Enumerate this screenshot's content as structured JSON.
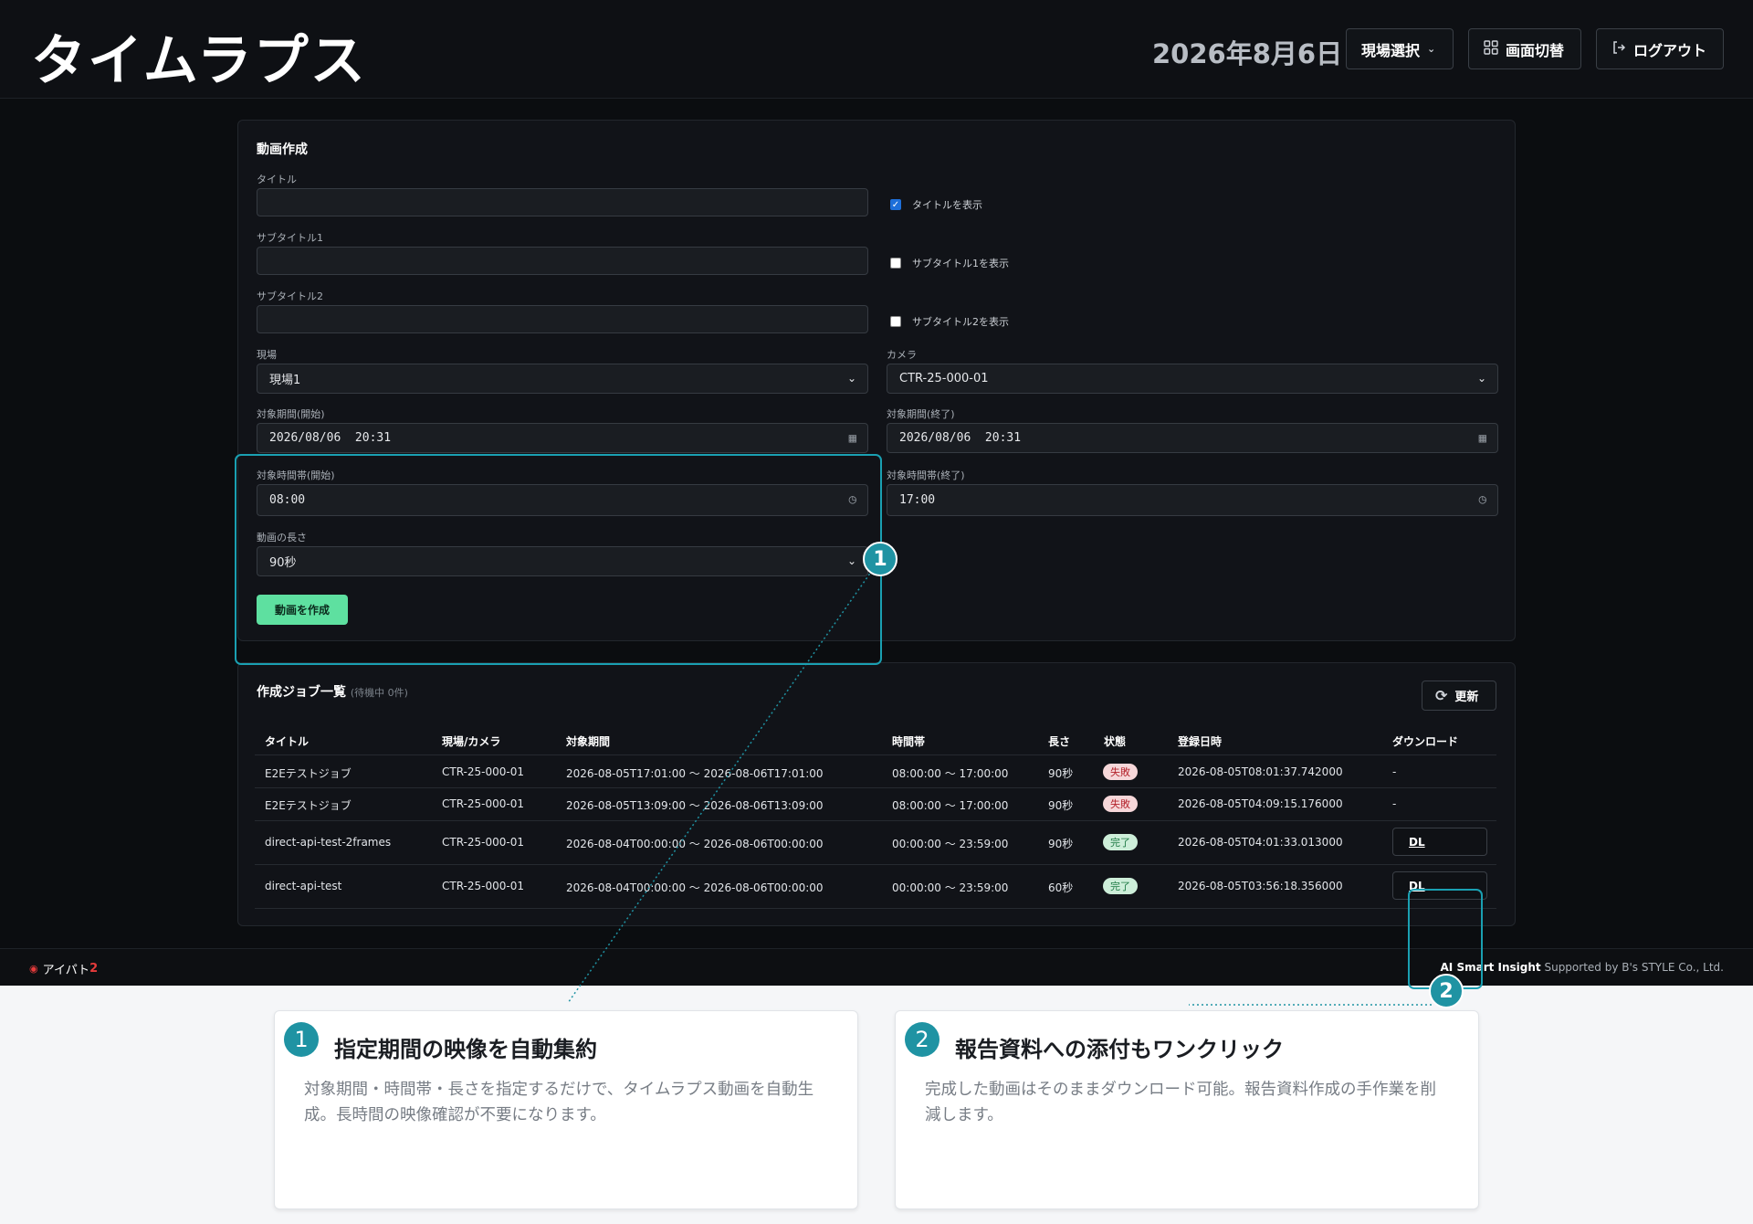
{
  "header": {
    "title": "タイムラプス",
    "date": "2026年8月6日",
    "site_select_label": "現場選択",
    "screen_switch_label": "画面切替",
    "logout_label": "ログアウト"
  },
  "form": {
    "section_title": "動画作成",
    "title_label": "タイトル",
    "title_value": "",
    "show_title_label": "タイトルを表示",
    "show_title_checked": true,
    "subtitle1_label": "サブタイトル1",
    "subtitle1_value": "",
    "show_subtitle1_label": "サブタイトル1を表示",
    "subtitle2_label": "サブタイトル2",
    "subtitle2_value": "",
    "show_subtitle2_label": "サブタイトル2を表示",
    "site_label": "現場",
    "site_value": "現場1",
    "camera_label": "カメラ",
    "camera_value": "CTR-25-000-01",
    "period_start_label": "対象期間(開始)",
    "period_start_value": "2026/08/06  20:31",
    "period_end_label": "対象期間(終了)",
    "period_end_value": "2026/08/06  20:31",
    "time_start_label": "対象時間帯(開始)",
    "time_start_value": "08:00",
    "time_end_label": "対象時間帯(終了)",
    "time_end_value": "17:00",
    "length_label": "動画の長さ",
    "length_value": "90秒",
    "create_button": "動画を作成"
  },
  "jobs": {
    "title": "作成ジョブ一覧",
    "subtitle": "(待機中 0件)",
    "refresh_label": "更新",
    "columns": [
      "タイトル",
      "現場/カメラ",
      "対象期間",
      "時間帯",
      "長さ",
      "状態",
      "登録日時",
      "ダウンロード"
    ],
    "rows": [
      {
        "title": "E2Eテストジョブ",
        "camera": "CTR-25-000-01",
        "period": "2026-08-05T17:01:00 〜 2026-08-06T17:01:00",
        "time": "08:00:00 〜 17:00:00",
        "length": "90秒",
        "status": "失敗",
        "registered": "2026-08-05T08:01:37.742000",
        "download": "-"
      },
      {
        "title": "E2Eテストジョブ",
        "camera": "CTR-25-000-01",
        "period": "2026-08-05T13:09:00 〜 2026-08-06T13:09:00",
        "time": "08:00:00 〜 17:00:00",
        "length": "90秒",
        "status": "失敗",
        "registered": "2026-08-05T04:09:15.176000",
        "download": "-"
      },
      {
        "title": "direct-api-test-2frames",
        "camera": "CTR-25-000-01",
        "period": "2026-08-04T00:00:00 〜 2026-08-06T00:00:00",
        "time": "00:00:00 〜 23:59:00",
        "length": "90秒",
        "status": "完了",
        "registered": "2026-08-05T04:01:33.013000",
        "download": "DL"
      },
      {
        "title": "direct-api-test",
        "camera": "CTR-25-000-01",
        "period": "2026-08-04T00:00:00 〜 2026-08-06T00:00:00",
        "time": "00:00:00 〜 23:59:00",
        "length": "60秒",
        "status": "完了",
        "registered": "2026-08-05T03:56:18.356000",
        "download": "DL"
      }
    ]
  },
  "footer": {
    "logo_text": "アイパト",
    "logo_suffix": "2",
    "brand_bold": "AI Smart Insight",
    "brand_rest": " Supported by B's STYLE Co., Ltd."
  },
  "callouts": [
    {
      "number": "1",
      "title": "指定期間の映像を自動集約",
      "body": "対象期間・時間帯・長さを指定するだけで、タイムラプス動画を自動生成。長時間の映像確認が不要になります。"
    },
    {
      "number": "2",
      "title": "報告資料への添付もワンクリック",
      "body": "完成した動画はそのままダウンロード可能。報告資料作成の手作業を削減します。"
    }
  ],
  "colors": {
    "accent_teal": "#1f93a3",
    "create_button": "#5ee0a0",
    "status_fail": "#b4232c",
    "status_ok": "#1e7a45"
  }
}
